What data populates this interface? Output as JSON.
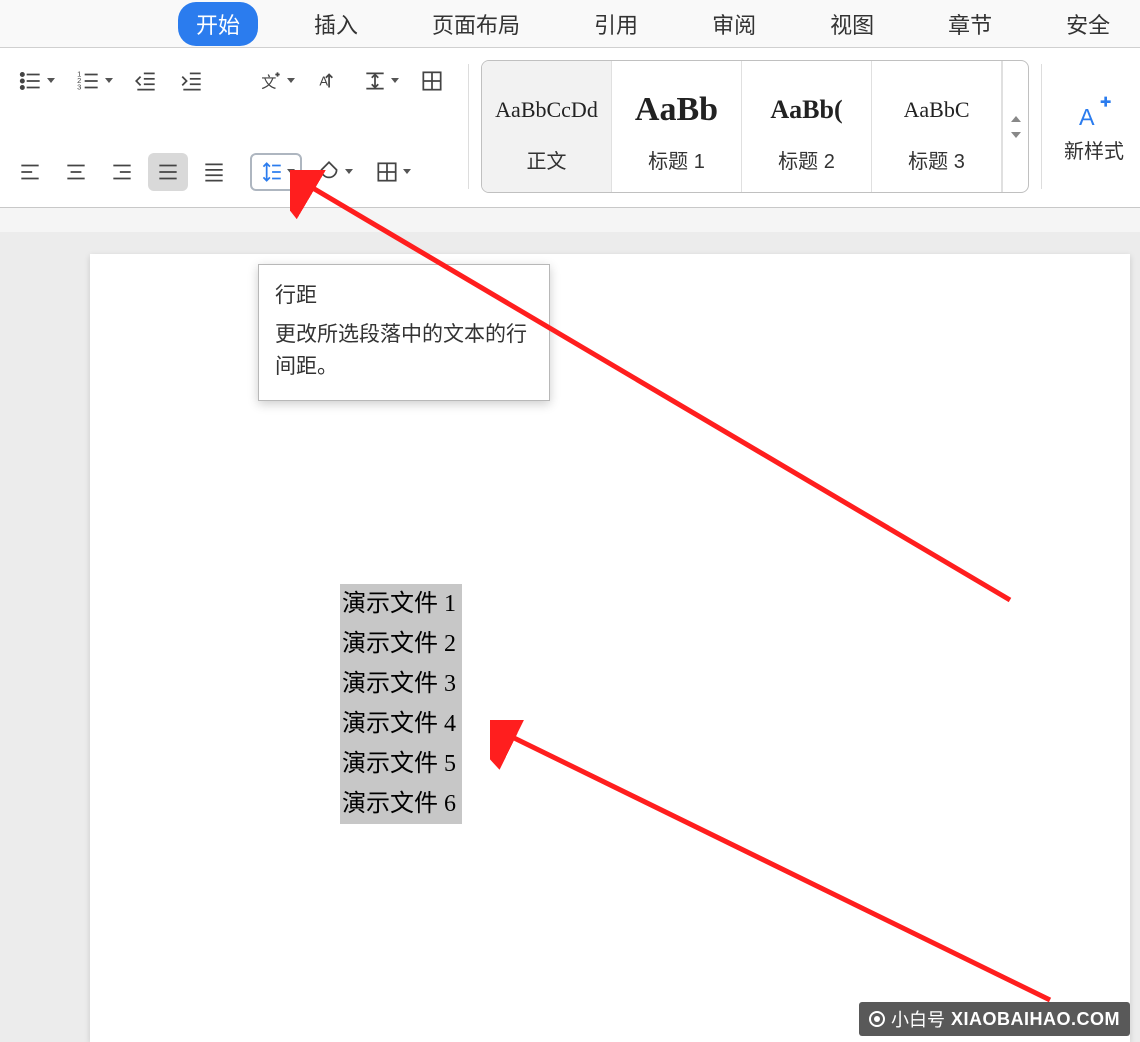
{
  "tabs": {
    "start": "开始",
    "insert": "插入",
    "layout": "页面布局",
    "references": "引用",
    "review": "审阅",
    "view": "视图",
    "chapter": "章节",
    "security": "安全"
  },
  "ribbon": {
    "newstyle_label": "新样式"
  },
  "styles": [
    {
      "sample": "AaBbCcDd",
      "label": "正文",
      "cls": ""
    },
    {
      "sample": "AaBb",
      "label": "标题 1",
      "cls": "big"
    },
    {
      "sample": "AaBb(",
      "label": "标题 2",
      "cls": "med"
    },
    {
      "sample": "AaBbC",
      "label": "标题 3",
      "cls": ""
    }
  ],
  "tooltip": {
    "title": "行距",
    "body": "更改所选段落中的文本的行间距。"
  },
  "document": {
    "lines": [
      "演示文件 1",
      "演示文件 2",
      "演示文件 3",
      "演示文件 4",
      "演示文件 5",
      "演示文件 6"
    ]
  },
  "watermark": {
    "name": "小白号",
    "domain": "XIAOBAIHAO.COM"
  }
}
